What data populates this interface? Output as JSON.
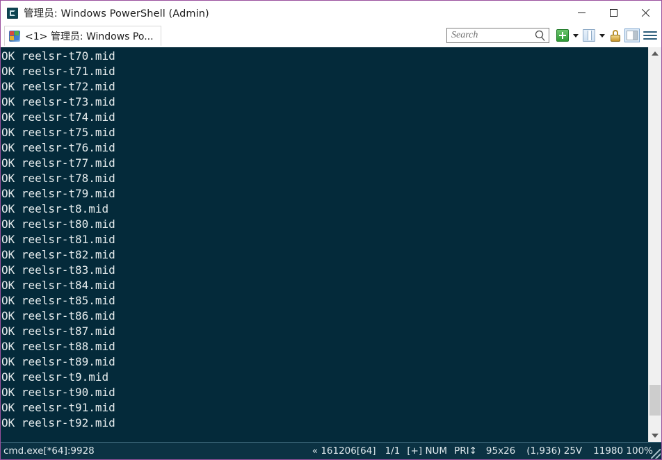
{
  "window": {
    "title": "管理员: Windows PowerShell (Admin)",
    "app_icon": "console-icon",
    "controls": {
      "minimize": "minimize-button",
      "maximize": "maximize-button",
      "close": "close-button"
    }
  },
  "tabs": [
    {
      "label": "<1> 管理员: Windows Po...",
      "icon": "windows-console-icon",
      "active": true
    }
  ],
  "toolbar": {
    "search": {
      "placeholder": "Search",
      "value": "",
      "icon": "magnifier-icon"
    },
    "new_tab": {
      "icon": "green-plus-icon",
      "label": ""
    },
    "new_tab_dropdown": {
      "icon": "chevron-down-icon"
    },
    "split_view": {
      "icon": "split-window-icon"
    },
    "split_view_dropdown": {
      "icon": "chevron-down-icon"
    },
    "lock": {
      "icon": "padlock-icon"
    },
    "panel_toggle": {
      "icon": "panel-toggle-icon",
      "active": true
    },
    "menu": {
      "icon": "hamburger-menu-icon"
    }
  },
  "console": {
    "background_color": "#042a3a",
    "text_color": "#e6eced",
    "lines": [
      "OK reelsr-t70.mid",
      "OK reelsr-t71.mid",
      "OK reelsr-t72.mid",
      "OK reelsr-t73.mid",
      "OK reelsr-t74.mid",
      "OK reelsr-t75.mid",
      "OK reelsr-t76.mid",
      "OK reelsr-t77.mid",
      "OK reelsr-t78.mid",
      "OK reelsr-t79.mid",
      "OK reelsr-t8.mid",
      "OK reelsr-t80.mid",
      "OK reelsr-t81.mid",
      "OK reelsr-t82.mid",
      "OK reelsr-t83.mid",
      "OK reelsr-t84.mid",
      "OK reelsr-t85.mid",
      "OK reelsr-t86.mid",
      "OK reelsr-t87.mid",
      "OK reelsr-t88.mid",
      "OK reelsr-t89.mid",
      "OK reelsr-t9.mid",
      "OK reelsr-t90.mid",
      "OK reelsr-t91.mid",
      "OK reelsr-t92.mid"
    ]
  },
  "scrollbar": {
    "up_arrow": "scroll-up-icon",
    "down_arrow": "scroll-down-icon"
  },
  "statusbar": {
    "process": "cmd.exe[*64]:9928",
    "cells": [
      "« 161206[64]",
      "1/1",
      "[+] NUM",
      "PRI↕",
      "95x26",
      "(1,936) 25V",
      "11980 100%"
    ]
  }
}
